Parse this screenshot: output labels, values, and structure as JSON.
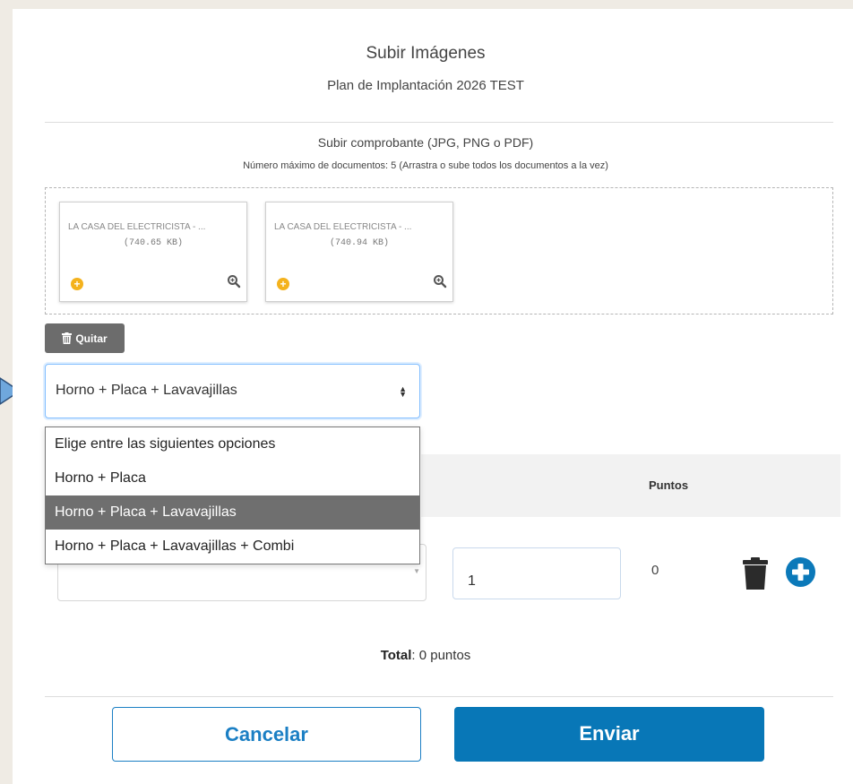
{
  "header": {
    "title": "Subir Imágenes",
    "subtitle": "Plan de Implantación 2026 TEST"
  },
  "upload": {
    "title": "Subir comprobante (JPG, PNG o PDF)",
    "note": "Número máximo de documentos: 5 (Arrastra o sube todos los documentos a la vez)",
    "files": [
      {
        "name": "LA CASA DEL ELECTRICISTA - ...",
        "size": "(740.65 KB)"
      },
      {
        "name": "LA CASA DEL ELECTRICISTA - ...",
        "size": "(740.94 KB)"
      }
    ],
    "remove_label": "Quitar"
  },
  "product_select": {
    "value": "Horno + Placa + Lavavajillas",
    "options": [
      "Elige entre las siguientes opciones",
      "Horno + Placa",
      "Horno + Placa + Lavavajillas",
      "Horno + Placa + Lavavajillas + Combi"
    ],
    "selected_index": 2
  },
  "table": {
    "points_header": "Puntos",
    "rows": [
      {
        "quantity": "1",
        "points": "0"
      }
    ]
  },
  "total": {
    "label": "Total",
    "value": ": 0 puntos"
  },
  "footer": {
    "cancel_label": "Cancelar",
    "send_label": "Enviar"
  },
  "colors": {
    "primary": "#0877b7",
    "accent_yellow": "#f4b21d",
    "arrow_fill": "#6fa7dc"
  },
  "icons": [
    "trash-icon",
    "plus-circle-icon",
    "zoom-icon",
    "arrow-pointer-icon",
    "sort-caret-icon"
  ]
}
